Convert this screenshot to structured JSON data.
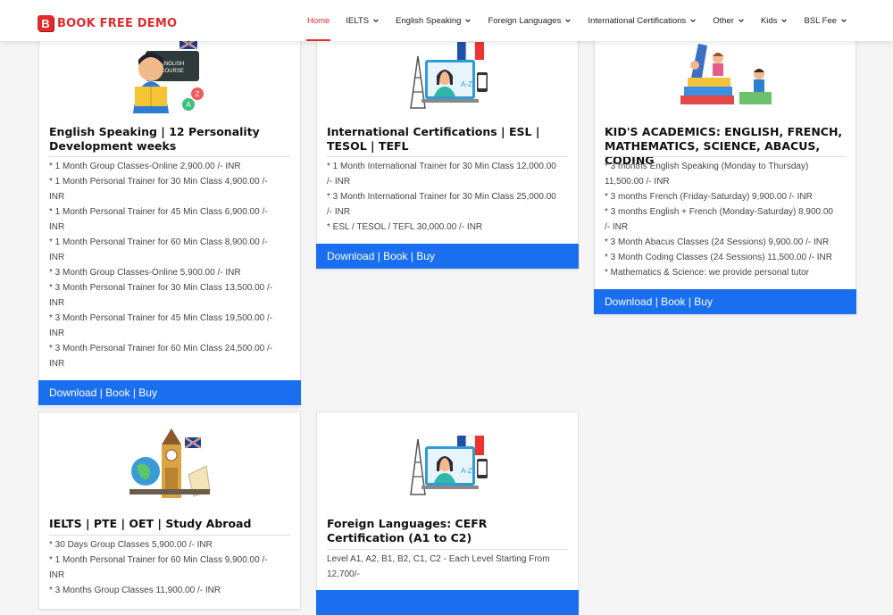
{
  "header": {
    "brand_letter": "B",
    "brand_text": "BOOK FREE DEMO",
    "nav": [
      {
        "label": "Home",
        "active": true,
        "dropdown": false
      },
      {
        "label": "IELTS",
        "active": false,
        "dropdown": true
      },
      {
        "label": "English Speaking",
        "active": false,
        "dropdown": true
      },
      {
        "label": "Foreign Languages",
        "active": false,
        "dropdown": true
      },
      {
        "label": "International Certifications",
        "active": false,
        "dropdown": true
      },
      {
        "label": "Other",
        "active": false,
        "dropdown": true
      },
      {
        "label": "Kids",
        "active": false,
        "dropdown": true
      },
      {
        "label": "BSL Fee",
        "active": false,
        "dropdown": true
      }
    ],
    "brand_color": "#e12b2b"
  },
  "cards": [
    {
      "title": "English Speaking | 12 Personality Development weeks",
      "illustration": "english-course-student-illustration",
      "items": [
        "* 1 Month Group Classes-Online 2,900.00 /- INR",
        "* 1 Month Personal Trainer for 30 Min Class 4,900.00 /- INR",
        "* 1 Month Personal Trainer for 45 Min Class 6,900.00 /- INR",
        "* 1 Month Personal Trainer for 60 Min Class 8,900.00 /- INR",
        "* 3 Month Group Classes-Online 5,900.00 /- INR",
        "* 3 Month Personal Trainer for 30 Min Class 13,500.00 /- INR",
        "* 3 Month Personal Trainer for 45 Min Class 19,500.00 /- INR",
        "* 3 Month Personal Trainer for 60 Min Class 24,500.00 /- INR"
      ],
      "button": "Download | Book | Buy"
    },
    {
      "title": "International Certifications | ESL | TESOL | TEFL",
      "illustration": "online-teacher-eiffel-illustration",
      "items": [
        "* 1 Month International Trainer for 30 Min Class 12,000.00 /- INR",
        "* 3 Month International Trainer for 30 Min Class 25,000.00 /- INR",
        "* ESL / TESOL / TEFL 30,000.00 /- INR"
      ],
      "button": "Download | Book | Buy"
    },
    {
      "title": "KID'S ACADEMICS: ENGLISH, FRENCH, MATHEMATICS, SCIENCE, ABACUS, CODING",
      "illustration": "kids-books-illustration",
      "items": [
        "* 3 months English Speaking (Monday to Thursday) 11,500.00 /- INR",
        "* 3 months French (Friday-Saturday) 9,900.00 /- INR",
        "* 3 months English + French (Monday-Saturday) 8,900.00 /- INR",
        "* 3 Month Abacus Classes (24 Sessions) 9,900.00 /- INR",
        "* 3 Month Coding Classes (24 Sessions) 11,500.00 /- INR",
        "* Mathematics & Science: we provide personal tutor"
      ],
      "button": "Download | Book | Buy"
    },
    {
      "title": "IELTS | PTE | OET | Study Abroad",
      "illustration": "study-abroad-landmarks-illustration",
      "items": [
        "* 30 Days Group Classes 5,900.00 /- INR",
        "* 1 Month Personal Trainer for 60 Min Class 9,900.00 /- INR",
        "* 3 Months Group Classes 11,900.00 /- INR"
      ],
      "button": ""
    },
    {
      "title": "Foreign Languages: CEFR Certification (A1 to C2)",
      "illustration": "online-teacher-eiffel-illustration",
      "items": [
        "Level A1, A2, B1, B2, C1, C2 - Each Level Starting From 12,700/-"
      ],
      "button": ""
    }
  ],
  "colors": {
    "button": "#1a6ff0",
    "accent": "#e12b2b"
  }
}
